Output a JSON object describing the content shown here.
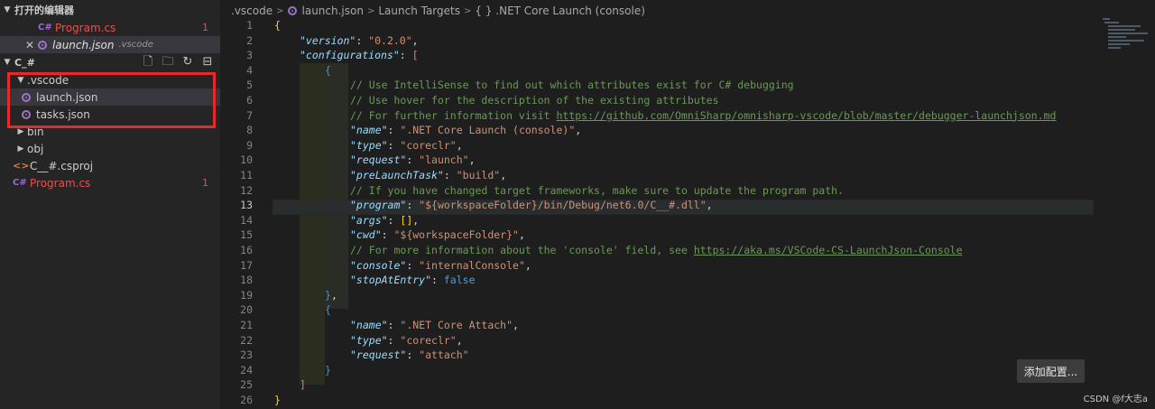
{
  "sidebar": {
    "open_editors_title": "打开的编辑器",
    "open_editors": [
      {
        "icon": "csharp-icon",
        "label": "Program.cs",
        "badge": "1"
      },
      {
        "icon": "json-icon",
        "label": "launch.json",
        "folder": ".vscode"
      }
    ],
    "folder_title": "C_#",
    "tree": [
      {
        "label": ".vscode"
      },
      {
        "label": "launch.json"
      },
      {
        "label": "tasks.json"
      },
      {
        "label": "bin"
      },
      {
        "label": "obj"
      },
      {
        "label": "C__#.csproj"
      },
      {
        "label": "Program.cs",
        "badge": "1"
      }
    ]
  },
  "breadcrumb": [
    ".vscode",
    "launch.json",
    "Launch Targets",
    "{ } .NET Core Launch (console)"
  ],
  "editor": {
    "active_line": 13,
    "line_numbers": [
      "1",
      "2",
      "3",
      "4",
      "5",
      "6",
      "7",
      "8",
      "9",
      "10",
      "11",
      "12",
      "13",
      "14",
      "15",
      "16",
      "17",
      "18",
      "19",
      "20",
      "21",
      "22",
      "23",
      "24",
      "25",
      "26"
    ],
    "strings": {
      "version_key": "\"version\"",
      "version_val": "\"0.2.0\"",
      "configurations_key": "\"configurations\"",
      "c1": "// Use IntelliSense to find out which attributes exist for C# debugging",
      "c2": "// Use hover for the description of the existing attributes",
      "c3a": "// For further information visit ",
      "c3b": "https://github.com/OmniSharp/omnisharp-vscode/blob/master/debugger-launchjson.md",
      "name_key": "\"name\"",
      "name_val": "\".NET Core Launch (console)\"",
      "type_key": "\"type\"",
      "type_val": "\"coreclr\"",
      "request_key": "\"request\"",
      "request_val": "\"launch\"",
      "prelaunch_key": "\"preLaunchTask\"",
      "prelaunch_val": "\"build\"",
      "c12": "// If you have changed target frameworks, make sure to update the program path.",
      "program_key": "\"program\"",
      "program_val": "\"${workspaceFolder}/bin/Debug/net6.0/C__#.dll\"",
      "args_key": "\"args\"",
      "cwd_key": "\"cwd\"",
      "cwd_val": "\"${workspaceFolder}\"",
      "c16a": "// For more information about the 'console' field, see ",
      "c16b": "https://aka.ms/VSCode-CS-LaunchJson-Console",
      "console_key": "\"console\"",
      "console_val": "\"internalConsole\"",
      "stop_key": "\"stopAtEntry\"",
      "stop_val": "false",
      "name2_val": "\".NET Core Attach\"",
      "type2_val": "\"coreclr\"",
      "request2_val": "\"attach\""
    }
  },
  "add_configuration_label": "添加配置...",
  "watermark": "CSDN @f大志a",
  "colors": {
    "highlight": "#e8282b",
    "accent": "#a074c4"
  }
}
